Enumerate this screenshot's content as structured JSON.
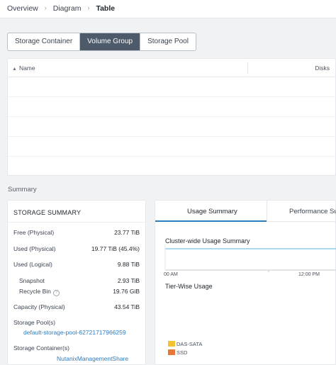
{
  "breadcrumb": {
    "items": [
      "Overview",
      "Diagram",
      "Table"
    ],
    "separator": "›",
    "active_index": 2
  },
  "segments": {
    "options": [
      "Storage Container",
      "Volume Group",
      "Storage Pool"
    ],
    "selected": "Volume Group"
  },
  "table": {
    "sort_icon": "▲",
    "columns": [
      "Name",
      "Disks"
    ],
    "rows": []
  },
  "summary": {
    "section_label": "Summary",
    "storage": {
      "title": "STORAGE SUMMARY",
      "free_label": "Free (Physical)",
      "free_value": "23.77 TiB",
      "used_phys_label": "Used (Physical)",
      "used_phys_value": "19.77 TiB (45.4%)",
      "used_logical_label": "Used (Logical)",
      "used_logical_value": "9.88 TiB",
      "snapshot_label": "Snapshot",
      "snapshot_value": "2.93 TiB",
      "recycle_label": "Recycle Bin",
      "recycle_value": "19.76 GiB",
      "capacity_label": "Capacity (Physical)",
      "capacity_value": "43.54 TiB",
      "pools_label": "Storage Pool(s)",
      "pool_link": "default-storage-pool-62721717966259",
      "containers_label": "Storage Container(s)",
      "container_link": "NutanixManagementShare"
    },
    "tabs": [
      "Usage Summary",
      "Performance Su"
    ],
    "active_tab": "Usage Summary",
    "chart": {
      "title": "Cluster-wide Usage Summary",
      "tier_title": "Tier-Wise Usage",
      "x_ticks": [
        "00 AM",
        "12:00 PM"
      ],
      "line_color": "#5bb3e0",
      "legend": [
        {
          "name": "DAS-SATA",
          "color": "#f2c230"
        },
        {
          "name": "SSD",
          "color": "#e8773a"
        }
      ]
    }
  }
}
